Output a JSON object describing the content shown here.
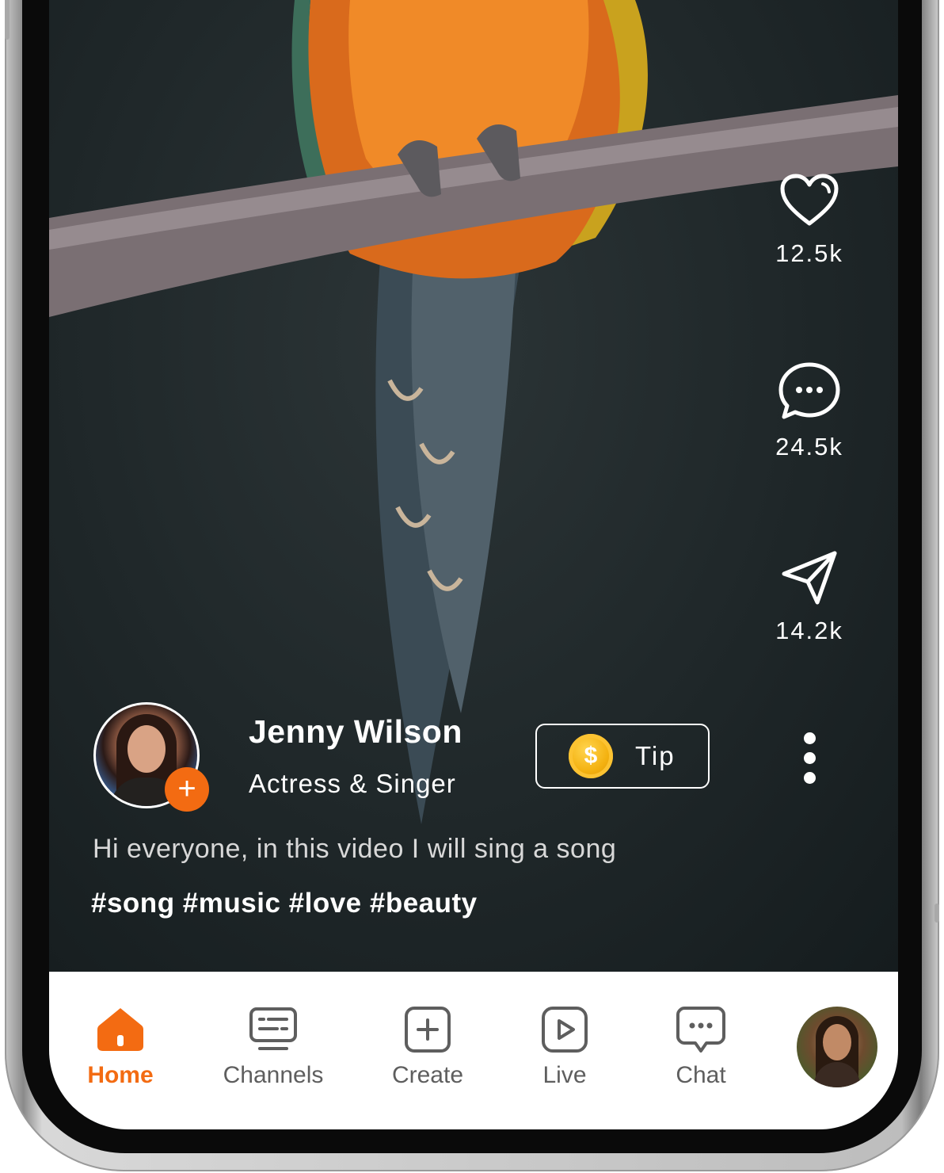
{
  "actions": {
    "likes": "12.5k",
    "comments": "24.5k",
    "shares": "14.2k"
  },
  "creator": {
    "name": "Jenny Wilson",
    "role": "Actress & Singer",
    "follow_glyph": "+"
  },
  "tip": {
    "coin_glyph": "$",
    "label": "Tip"
  },
  "post": {
    "caption": "Hi everyone, in this video I will sing a song",
    "hashtags": "#song #music #love #beauty"
  },
  "nav": {
    "home": "Home",
    "channels": "Channels",
    "create": "Create",
    "live": "Live",
    "chat": "Chat"
  },
  "colors": {
    "accent": "#f36b12",
    "background": "#1f2729",
    "nav_inactive": "#5e5e5e"
  },
  "icons": [
    "heart-icon",
    "comment-icon",
    "send-icon",
    "coin-icon",
    "more-icon",
    "home-icon",
    "channels-icon",
    "create-icon",
    "live-icon",
    "chat-icon"
  ]
}
